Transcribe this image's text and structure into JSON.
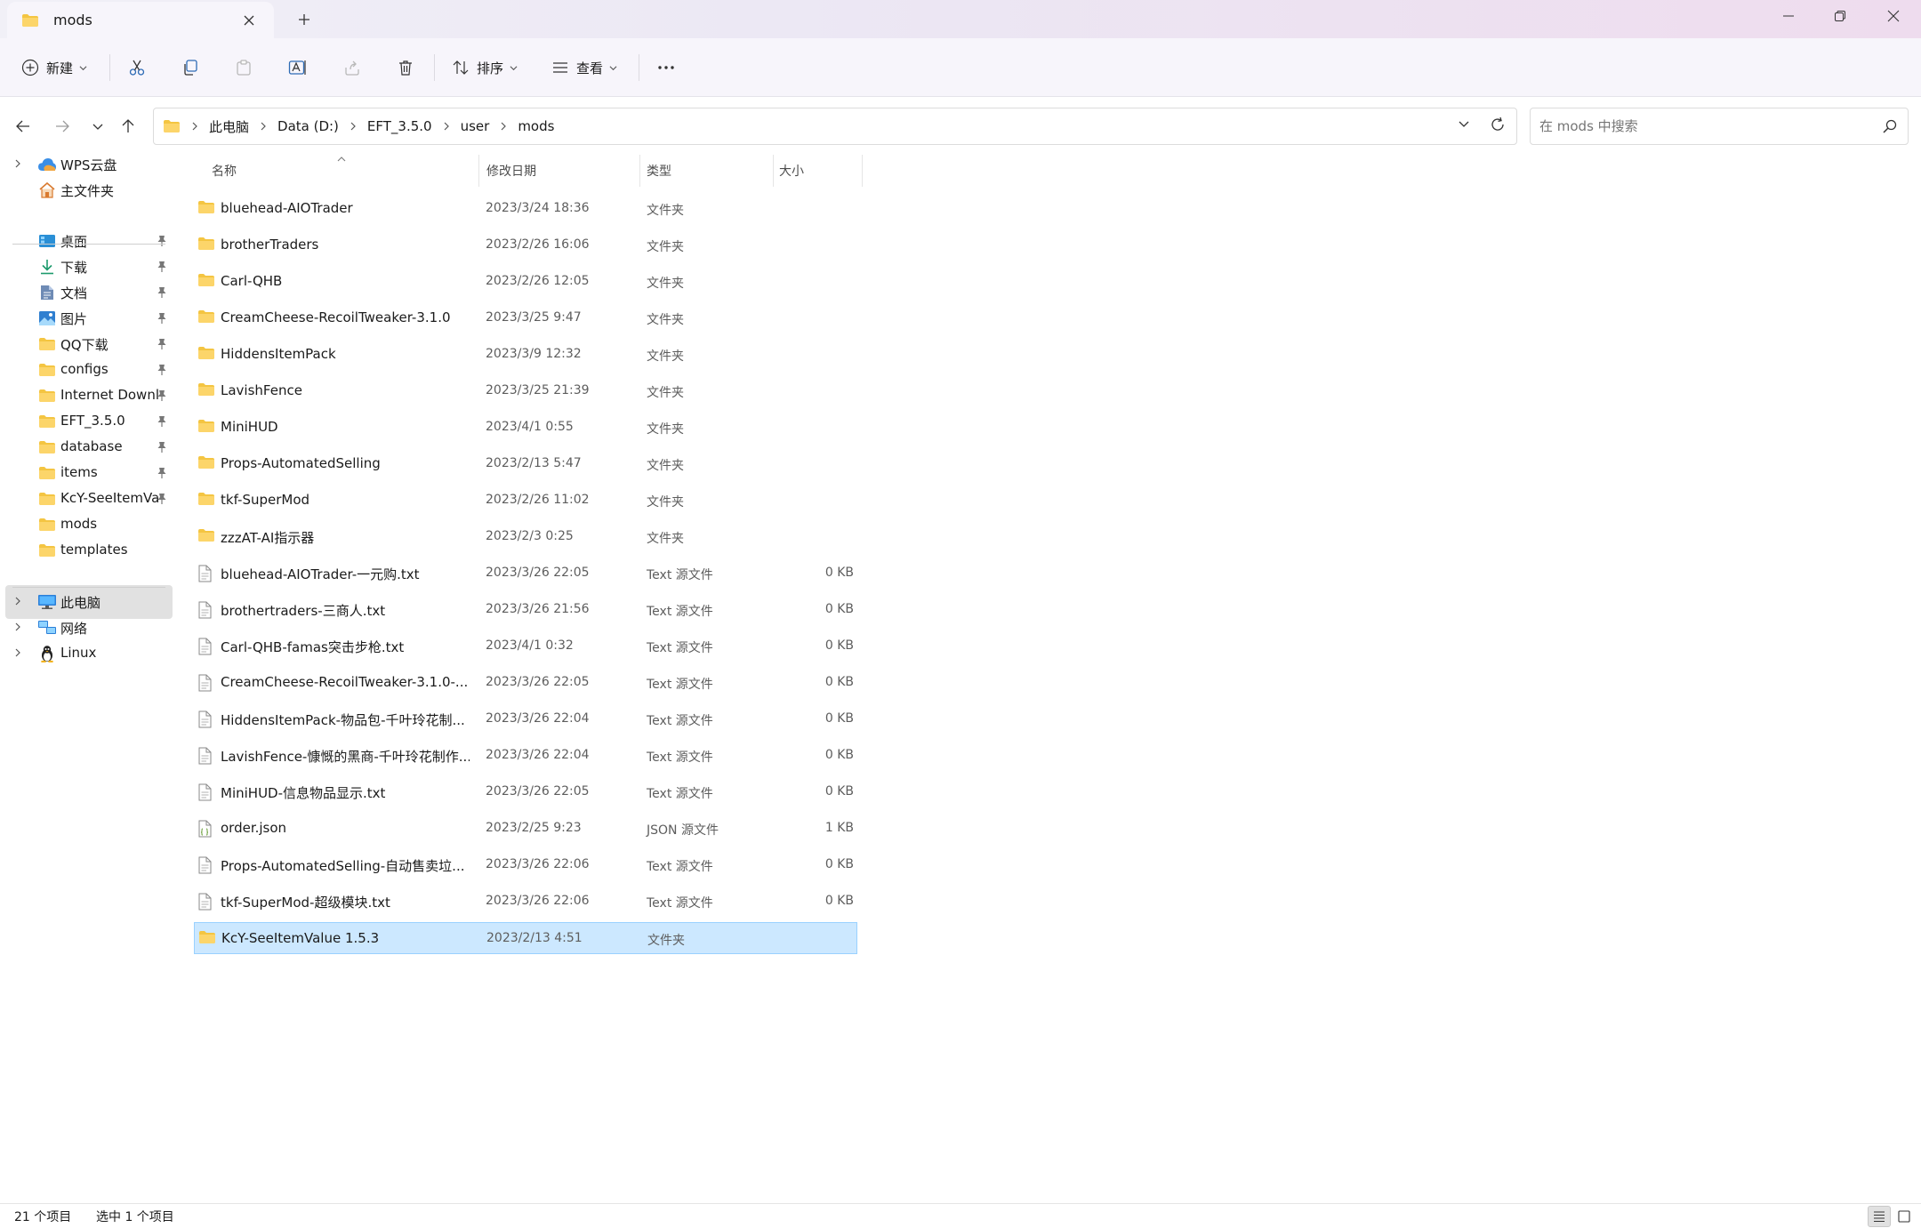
{
  "window": {
    "tab_title": "mods",
    "new_tab_symbol": "+"
  },
  "commandbar": {
    "new_label": "新建",
    "sort_label": "排序",
    "view_label": "查看"
  },
  "address": {
    "breadcrumbs": [
      "此电脑",
      "Data (D:)",
      "EFT_3.5.0",
      "user",
      "mods"
    ]
  },
  "search": {
    "placeholder": "在 mods 中搜索"
  },
  "sidebar": {
    "items": [
      {
        "label": "WPS云盘",
        "icon": "cloud-icon",
        "expander": true,
        "pin": false
      },
      {
        "label": "主文件夹",
        "icon": "home-icon",
        "expander": false,
        "pin": false
      },
      {
        "label": "桌面",
        "icon": "desktop-icon",
        "expander": false,
        "pin": true
      },
      {
        "label": "下载",
        "icon": "download-icon",
        "expander": false,
        "pin": true
      },
      {
        "label": "文档",
        "icon": "documents-icon",
        "expander": false,
        "pin": true
      },
      {
        "label": "图片",
        "icon": "pictures-icon",
        "expander": false,
        "pin": true
      },
      {
        "label": "QQ下载",
        "icon": "folder-icon",
        "expander": false,
        "pin": true
      },
      {
        "label": "configs",
        "icon": "folder-icon",
        "expander": false,
        "pin": true
      },
      {
        "label": "Internet Downl",
        "icon": "folder-icon",
        "expander": false,
        "pin": true
      },
      {
        "label": "EFT_3.5.0",
        "icon": "folder-icon",
        "expander": false,
        "pin": true
      },
      {
        "label": "database",
        "icon": "folder-icon",
        "expander": false,
        "pin": true
      },
      {
        "label": "items",
        "icon": "folder-icon",
        "expander": false,
        "pin": true
      },
      {
        "label": "KcY-SeeItemVa",
        "icon": "folder-icon",
        "expander": false,
        "pin": true
      },
      {
        "label": "mods",
        "icon": "folder-icon",
        "expander": false,
        "pin": false
      },
      {
        "label": "templates",
        "icon": "folder-icon",
        "expander": false,
        "pin": false
      },
      {
        "label": "此电脑",
        "icon": "computer-icon",
        "expander": true,
        "pin": false,
        "selected": true
      },
      {
        "label": "网络",
        "icon": "network-icon",
        "expander": true,
        "pin": false
      },
      {
        "label": "Linux",
        "icon": "linux-icon",
        "expander": true,
        "pin": false
      }
    ]
  },
  "filelist": {
    "columns": {
      "name": "名称",
      "date": "修改日期",
      "type": "类型",
      "size": "大小"
    },
    "rows": [
      {
        "name": "bluehead-AIOTrader",
        "date": "2023/3/24 18:36",
        "type": "文件夹",
        "size": "",
        "kind": "folder"
      },
      {
        "name": "brotherTraders",
        "date": "2023/2/26 16:06",
        "type": "文件夹",
        "size": "",
        "kind": "folder"
      },
      {
        "name": "Carl-QHB",
        "date": "2023/2/26 12:05",
        "type": "文件夹",
        "size": "",
        "kind": "folder"
      },
      {
        "name": "CreamCheese-RecoilTweaker-3.1.0",
        "date": "2023/3/25 9:47",
        "type": "文件夹",
        "size": "",
        "kind": "folder"
      },
      {
        "name": "HiddensItemPack",
        "date": "2023/3/9 12:32",
        "type": "文件夹",
        "size": "",
        "kind": "folder"
      },
      {
        "name": "LavishFence",
        "date": "2023/3/25 21:39",
        "type": "文件夹",
        "size": "",
        "kind": "folder"
      },
      {
        "name": "MiniHUD",
        "date": "2023/4/1 0:55",
        "type": "文件夹",
        "size": "",
        "kind": "folder"
      },
      {
        "name": "Props-AutomatedSelling",
        "date": "2023/2/13 5:47",
        "type": "文件夹",
        "size": "",
        "kind": "folder"
      },
      {
        "name": "tkf-SuperMod",
        "date": "2023/2/26 11:02",
        "type": "文件夹",
        "size": "",
        "kind": "folder"
      },
      {
        "name": "zzzAT-AI指示器",
        "date": "2023/2/3 0:25",
        "type": "文件夹",
        "size": "",
        "kind": "folder"
      },
      {
        "name": "bluehead-AIOTrader-一元购.txt",
        "date": "2023/3/26 22:05",
        "type": "Text 源文件",
        "size": "0 KB",
        "kind": "text"
      },
      {
        "name": "brothertraders-三商人.txt",
        "date": "2023/3/26 21:56",
        "type": "Text 源文件",
        "size": "0 KB",
        "kind": "text"
      },
      {
        "name": "Carl-QHB-famas突击步枪.txt",
        "date": "2023/4/1 0:32",
        "type": "Text 源文件",
        "size": "0 KB",
        "kind": "text"
      },
      {
        "name": "CreamCheese-RecoilTweaker-3.1.0-...",
        "date": "2023/3/26 22:05",
        "type": "Text 源文件",
        "size": "0 KB",
        "kind": "text"
      },
      {
        "name": "HiddensItemPack-物品包-千叶玲花制...",
        "date": "2023/3/26 22:04",
        "type": "Text 源文件",
        "size": "0 KB",
        "kind": "text"
      },
      {
        "name": "LavishFence-慷慨的黑商-千叶玲花制作....",
        "date": "2023/3/26 22:04",
        "type": "Text 源文件",
        "size": "0 KB",
        "kind": "text"
      },
      {
        "name": "MiniHUD-信息物品显示.txt",
        "date": "2023/3/26 22:05",
        "type": "Text 源文件",
        "size": "0 KB",
        "kind": "text"
      },
      {
        "name": "order.json",
        "date": "2023/2/25 9:23",
        "type": "JSON 源文件",
        "size": "1 KB",
        "kind": "json"
      },
      {
        "name": "Props-AutomatedSelling-自动售卖垃...",
        "date": "2023/3/26 22:06",
        "type": "Text 源文件",
        "size": "0 KB",
        "kind": "text"
      },
      {
        "name": "tkf-SuperMod-超级模块.txt",
        "date": "2023/3/26 22:06",
        "type": "Text 源文件",
        "size": "0 KB",
        "kind": "text"
      },
      {
        "name": "KcY-SeeItemValue 1.5.3",
        "date": "2023/2/13 4:51",
        "type": "文件夹",
        "size": "",
        "kind": "folder",
        "selected": true
      }
    ]
  },
  "status": {
    "item_count": "21 个项目",
    "selected_count": "选中 1 个项目"
  },
  "colors": {
    "folder": "#f4c542",
    "selection_bg": "#cce8ff",
    "selection_border": "#99d1ff",
    "accent": "#0067c0"
  }
}
